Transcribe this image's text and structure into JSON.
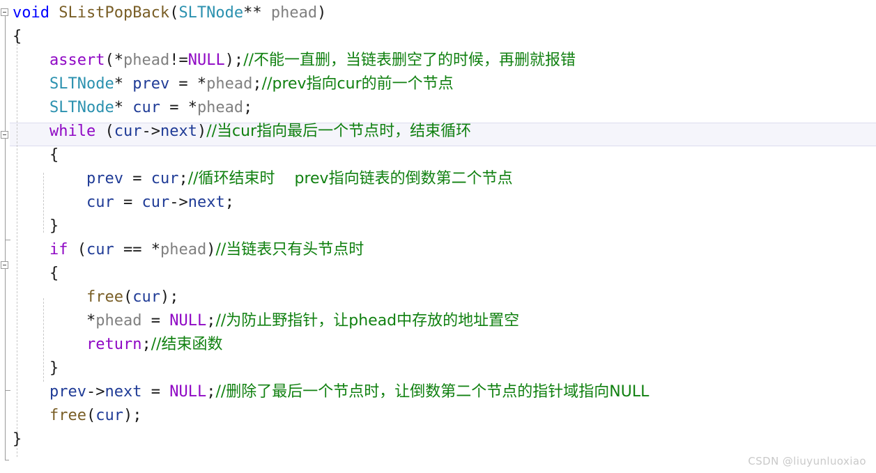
{
  "editor": {
    "language": "c",
    "font_size_px": 22,
    "line_height_px": 34,
    "background": "#ffffff",
    "current_line_index": 4,
    "current_line_highlight": "#f5f5fb"
  },
  "colors": {
    "keyword": "#0000ff",
    "control_keyword": "#8f08c4",
    "type": "#2b91af",
    "function": "#795e26",
    "variable": "#1f3b96",
    "parameter": "#808080",
    "punctuation": "#1a1a1a",
    "comment": "#108010",
    "gutter_line": "#9a9a9a",
    "indent_guide": "#c8c8c8",
    "watermark": "#c9c9c9"
  },
  "watermark": {
    "text": "CSDN @liuyunluoxiao"
  },
  "gutter": {
    "fold_markers": [
      {
        "name": "fold-function",
        "line": 0,
        "state": "expanded",
        "glyph": "minus"
      },
      {
        "name": "fold-while",
        "line": 4,
        "state": "expanded",
        "glyph": "minus"
      },
      {
        "name": "fold-if",
        "line": 9,
        "state": "expanded",
        "glyph": "minus"
      }
    ]
  },
  "code": {
    "lines": [
      {
        "index": 0,
        "text": "void SListPopBack(SLTNode** phead)",
        "tokens": [
          {
            "t": "void",
            "c": "t-kw"
          },
          {
            "t": " ",
            "c": "t-punct"
          },
          {
            "t": "SListPopBack",
            "c": "t-fn"
          },
          {
            "t": "(",
            "c": "t-punct"
          },
          {
            "t": "SLTNode",
            "c": "t-type"
          },
          {
            "t": "** ",
            "c": "t-punct"
          },
          {
            "t": "phead",
            "c": "t-param"
          },
          {
            "t": ")",
            "c": "t-punct"
          }
        ]
      },
      {
        "index": 1,
        "text": "{",
        "tokens": [
          {
            "t": "{",
            "c": "t-punct"
          }
        ]
      },
      {
        "index": 2,
        "text": "    assert(*phead!=NULL);//不能一直删，当链表删空了的时候，再删就报错",
        "tokens": [
          {
            "t": "    ",
            "c": "t-punct"
          },
          {
            "t": "assert",
            "c": "t-ctrl"
          },
          {
            "t": "(*",
            "c": "t-punct"
          },
          {
            "t": "phead",
            "c": "t-param"
          },
          {
            "t": "!=",
            "c": "t-punct"
          },
          {
            "t": "NULL",
            "c": "t-ctrl"
          },
          {
            "t": ");",
            "c": "t-punct"
          },
          {
            "t": "//不能一直删，当链表删空了的时候，再删就报错",
            "c": "t-cmt"
          }
        ]
      },
      {
        "index": 3,
        "text": "    SLTNode* prev = *phead;//prev指向cur的前一个节点",
        "tokens": [
          {
            "t": "    ",
            "c": "t-punct"
          },
          {
            "t": "SLTNode",
            "c": "t-type"
          },
          {
            "t": "* ",
            "c": "t-punct"
          },
          {
            "t": "prev",
            "c": "t-var"
          },
          {
            "t": " = *",
            "c": "t-punct"
          },
          {
            "t": "phead",
            "c": "t-param"
          },
          {
            "t": ";",
            "c": "t-punct"
          },
          {
            "t": "//prev指向cur的前一个节点",
            "c": "t-cmt"
          }
        ]
      },
      {
        "index": 4,
        "text": "    SLTNode* cur = *phead;",
        "tokens": [
          {
            "t": "    ",
            "c": "t-punct"
          },
          {
            "t": "SLTNode",
            "c": "t-type"
          },
          {
            "t": "* ",
            "c": "t-punct"
          },
          {
            "t": "cur",
            "c": "t-var"
          },
          {
            "t": " = *",
            "c": "t-punct"
          },
          {
            "t": "phead",
            "c": "t-param"
          },
          {
            "t": ";",
            "c": "t-punct"
          }
        ]
      },
      {
        "index": 5,
        "text": "    while (cur->next)//当cur指向最后一个节点时，结束循环",
        "tokens": [
          {
            "t": "    ",
            "c": "t-punct"
          },
          {
            "t": "while",
            "c": "t-ctrl"
          },
          {
            "t": " (",
            "c": "t-punct"
          },
          {
            "t": "cur",
            "c": "t-var"
          },
          {
            "t": "->",
            "c": "t-punct"
          },
          {
            "t": "next",
            "c": "t-var"
          },
          {
            "t": ")",
            "c": "t-punct"
          },
          {
            "t": "//当cur指向最后一个节点时，结束循环",
            "c": "t-cmt"
          }
        ]
      },
      {
        "index": 6,
        "text": "    {",
        "tokens": [
          {
            "t": "    {",
            "c": "t-punct"
          }
        ]
      },
      {
        "index": 7,
        "text": "        prev = cur;//循环结束时    prev指向链表的倒数第二个节点",
        "tokens": [
          {
            "t": "        ",
            "c": "t-punct"
          },
          {
            "t": "prev",
            "c": "t-var"
          },
          {
            "t": " = ",
            "c": "t-punct"
          },
          {
            "t": "cur",
            "c": "t-var"
          },
          {
            "t": ";",
            "c": "t-punct"
          },
          {
            "t": "//循环结束时    prev指向链表的倒数第二个节点",
            "c": "t-cmt"
          }
        ]
      },
      {
        "index": 8,
        "text": "        cur = cur->next;",
        "tokens": [
          {
            "t": "        ",
            "c": "t-punct"
          },
          {
            "t": "cur",
            "c": "t-var"
          },
          {
            "t": " = ",
            "c": "t-punct"
          },
          {
            "t": "cur",
            "c": "t-var"
          },
          {
            "t": "->",
            "c": "t-punct"
          },
          {
            "t": "next",
            "c": "t-var"
          },
          {
            "t": ";",
            "c": "t-punct"
          }
        ]
      },
      {
        "index": 9,
        "text": "    }",
        "tokens": [
          {
            "t": "    }",
            "c": "t-punct"
          }
        ]
      },
      {
        "index": 10,
        "text": "    if (cur == *phead)//当链表只有头节点时",
        "tokens": [
          {
            "t": "    ",
            "c": "t-punct"
          },
          {
            "t": "if",
            "c": "t-ctrl"
          },
          {
            "t": " (",
            "c": "t-punct"
          },
          {
            "t": "cur",
            "c": "t-var"
          },
          {
            "t": " == *",
            "c": "t-punct"
          },
          {
            "t": "phead",
            "c": "t-param"
          },
          {
            "t": ")",
            "c": "t-punct"
          },
          {
            "t": "//当链表只有头节点时",
            "c": "t-cmt"
          }
        ]
      },
      {
        "index": 11,
        "text": "    {",
        "tokens": [
          {
            "t": "    {",
            "c": "t-punct"
          }
        ]
      },
      {
        "index": 12,
        "text": "        free(cur);",
        "tokens": [
          {
            "t": "        ",
            "c": "t-punct"
          },
          {
            "t": "free",
            "c": "t-fn"
          },
          {
            "t": "(",
            "c": "t-punct"
          },
          {
            "t": "cur",
            "c": "t-var"
          },
          {
            "t": ");",
            "c": "t-punct"
          }
        ]
      },
      {
        "index": 13,
        "text": "        *phead = NULL;//为防止野指针，让phead中存放的地址置空",
        "tokens": [
          {
            "t": "        *",
            "c": "t-punct"
          },
          {
            "t": "phead",
            "c": "t-param"
          },
          {
            "t": " = ",
            "c": "t-punct"
          },
          {
            "t": "NULL",
            "c": "t-ctrl"
          },
          {
            "t": ";",
            "c": "t-punct"
          },
          {
            "t": "//为防止野指针，让phead中存放的地址置空",
            "c": "t-cmt"
          }
        ]
      },
      {
        "index": 14,
        "text": "        return;//结束函数",
        "tokens": [
          {
            "t": "        ",
            "c": "t-punct"
          },
          {
            "t": "return",
            "c": "t-ctrl"
          },
          {
            "t": ";",
            "c": "t-punct"
          },
          {
            "t": "//结束函数",
            "c": "t-cmt"
          }
        ]
      },
      {
        "index": 15,
        "text": "    }",
        "tokens": [
          {
            "t": "    }",
            "c": "t-punct"
          }
        ]
      },
      {
        "index": 16,
        "text": "    prev->next = NULL;//删除了最后一个节点时，让倒数第二个节点的指针域指向NULL",
        "tokens": [
          {
            "t": "    ",
            "c": "t-punct"
          },
          {
            "t": "prev",
            "c": "t-var"
          },
          {
            "t": "->",
            "c": "t-punct"
          },
          {
            "t": "next",
            "c": "t-var"
          },
          {
            "t": " = ",
            "c": "t-punct"
          },
          {
            "t": "NULL",
            "c": "t-ctrl"
          },
          {
            "t": ";",
            "c": "t-punct"
          },
          {
            "t": "//删除了最后一个节点时，让倒数第二个节点的指针域指向NULL",
            "c": "t-cmt"
          }
        ]
      },
      {
        "index": 17,
        "text": "    free(cur);",
        "tokens": [
          {
            "t": "    ",
            "c": "t-punct"
          },
          {
            "t": "free",
            "c": "t-fn"
          },
          {
            "t": "(",
            "c": "t-punct"
          },
          {
            "t": "cur",
            "c": "t-var"
          },
          {
            "t": ");",
            "c": "t-punct"
          }
        ]
      },
      {
        "index": 18,
        "text": "}",
        "tokens": [
          {
            "t": "}",
            "c": "t-punct"
          }
        ]
      }
    ]
  }
}
